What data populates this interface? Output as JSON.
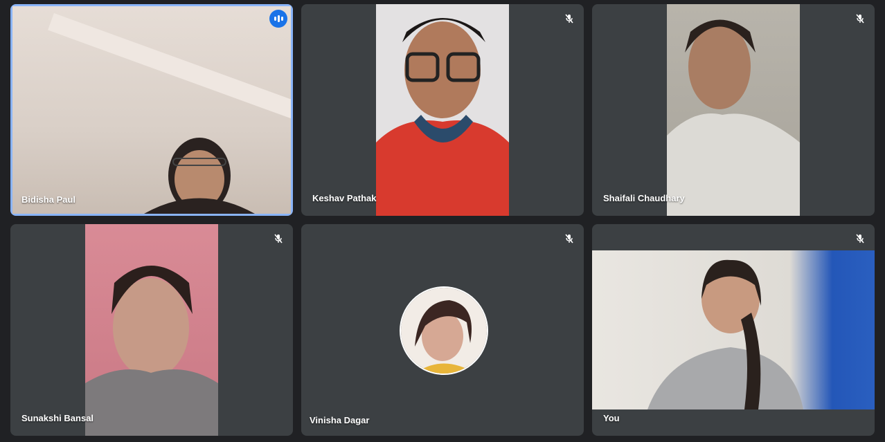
{
  "participants": [
    {
      "name": "Bidisha Paul",
      "speaking": true,
      "muted": false
    },
    {
      "name": "Keshav Pathak",
      "muted": true
    },
    {
      "name": "Shaifali Chaudhary",
      "muted": true
    },
    {
      "name": "Sunakshi Bansal",
      "muted": true
    },
    {
      "name": "Vinisha Dagar",
      "muted": true,
      "camera_off": true
    },
    {
      "name": "You",
      "muted": true
    }
  ],
  "colors": {
    "tile": "#3c4043",
    "background": "#202124",
    "active_outline": "#8ab4f8",
    "speaking": "#1a73e8"
  },
  "icons": {
    "muted": "mic-off-icon",
    "speaking": "audio-level-icon"
  }
}
